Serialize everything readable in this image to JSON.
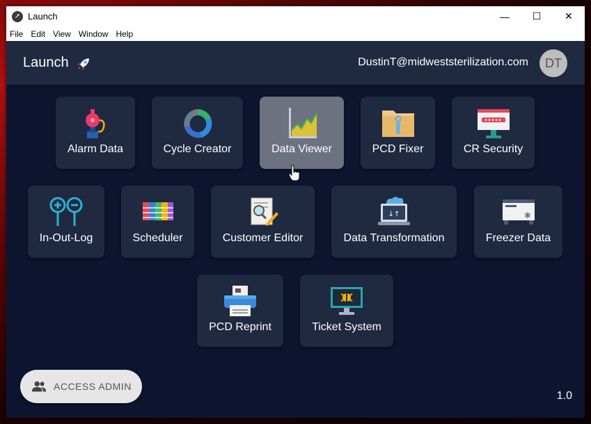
{
  "window": {
    "title": "Launch",
    "min": "—",
    "max": "☐",
    "close": "✕"
  },
  "menu": [
    "File",
    "Edit",
    "View",
    "Window",
    "Help"
  ],
  "header": {
    "title": "Launch",
    "email": "DustinT@midweststerilization.com",
    "avatar": "DT"
  },
  "tiles": [
    {
      "label": "Alarm Data",
      "icon": "alarm-icon"
    },
    {
      "label": "Cycle Creator",
      "icon": "cycle-ring-icon"
    },
    {
      "label": "Data Viewer",
      "icon": "chart-icon",
      "active": true
    },
    {
      "label": "PCD Fixer",
      "icon": "folder-wrench-icon"
    },
    {
      "label": "CR Security",
      "icon": "password-screen-icon"
    },
    {
      "label": "In-Out-Log",
      "icon": "plus-minus-icon"
    },
    {
      "label": "Scheduler",
      "icon": "schedule-board-icon"
    },
    {
      "label": "Customer Editor",
      "icon": "document-edit-icon"
    },
    {
      "label": "Data Transformation",
      "icon": "cloud-laptop-icon"
    },
    {
      "label": "Freezer Data",
      "icon": "freezer-icon"
    },
    {
      "label": "PCD Reprint",
      "icon": "printer-icon"
    },
    {
      "label": "Ticket System",
      "icon": "bug-monitor-icon"
    }
  ],
  "admin_button": {
    "label": "ACCESS ADMIN",
    "icon": "people-icon"
  },
  "version": "1.0",
  "colors": {
    "background": "#0d1530",
    "tile": "#1f2940",
    "active_tile": "#6d7281",
    "header": "#1f2940"
  }
}
